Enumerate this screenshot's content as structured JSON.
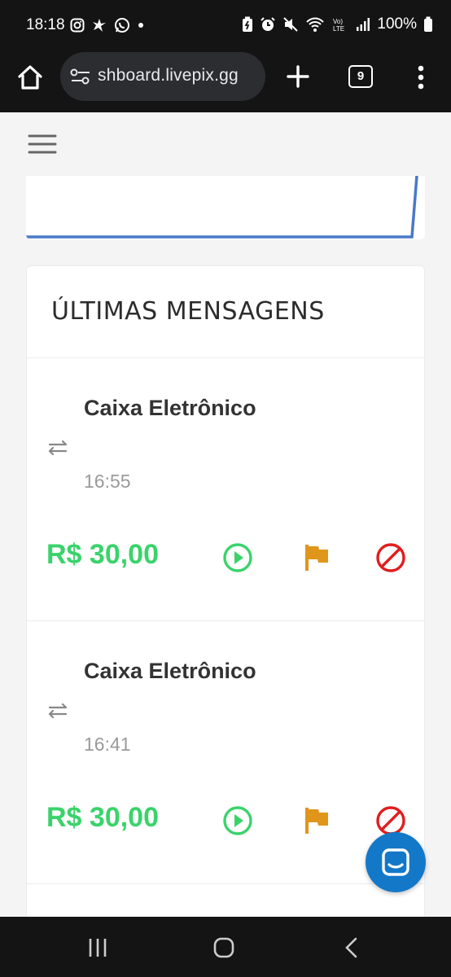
{
  "status_bar": {
    "time": "18:18",
    "battery": "100%",
    "left_icons": [
      "instagram-icon",
      "bird-icon",
      "whatsapp-icon",
      "dot-icon"
    ],
    "right_icons": [
      "battery-saver-icon",
      "alarm-icon",
      "mute-icon",
      "wifi-icon",
      "volte-icon",
      "signal-icon",
      "battery-icon"
    ]
  },
  "browser": {
    "url": "shboard.livepix.gg",
    "tab_count": "9"
  },
  "messages": {
    "title": "ÚLTIMAS MENSAGENS",
    "items": [
      {
        "name": "Caixa Eletrônico",
        "time": "16:55",
        "amount": "R$ 30,00"
      },
      {
        "name": "Caixa Eletrônico",
        "time": "16:41",
        "amount": "R$ 30,00"
      }
    ]
  },
  "colors": {
    "amount_green": "#3ad36b",
    "play_green": "#3ad36b",
    "flag_orange": "#e0961a",
    "block_red": "#e11d1d",
    "chart_blue": "#4a78c8",
    "fab_blue": "#1478c8"
  }
}
